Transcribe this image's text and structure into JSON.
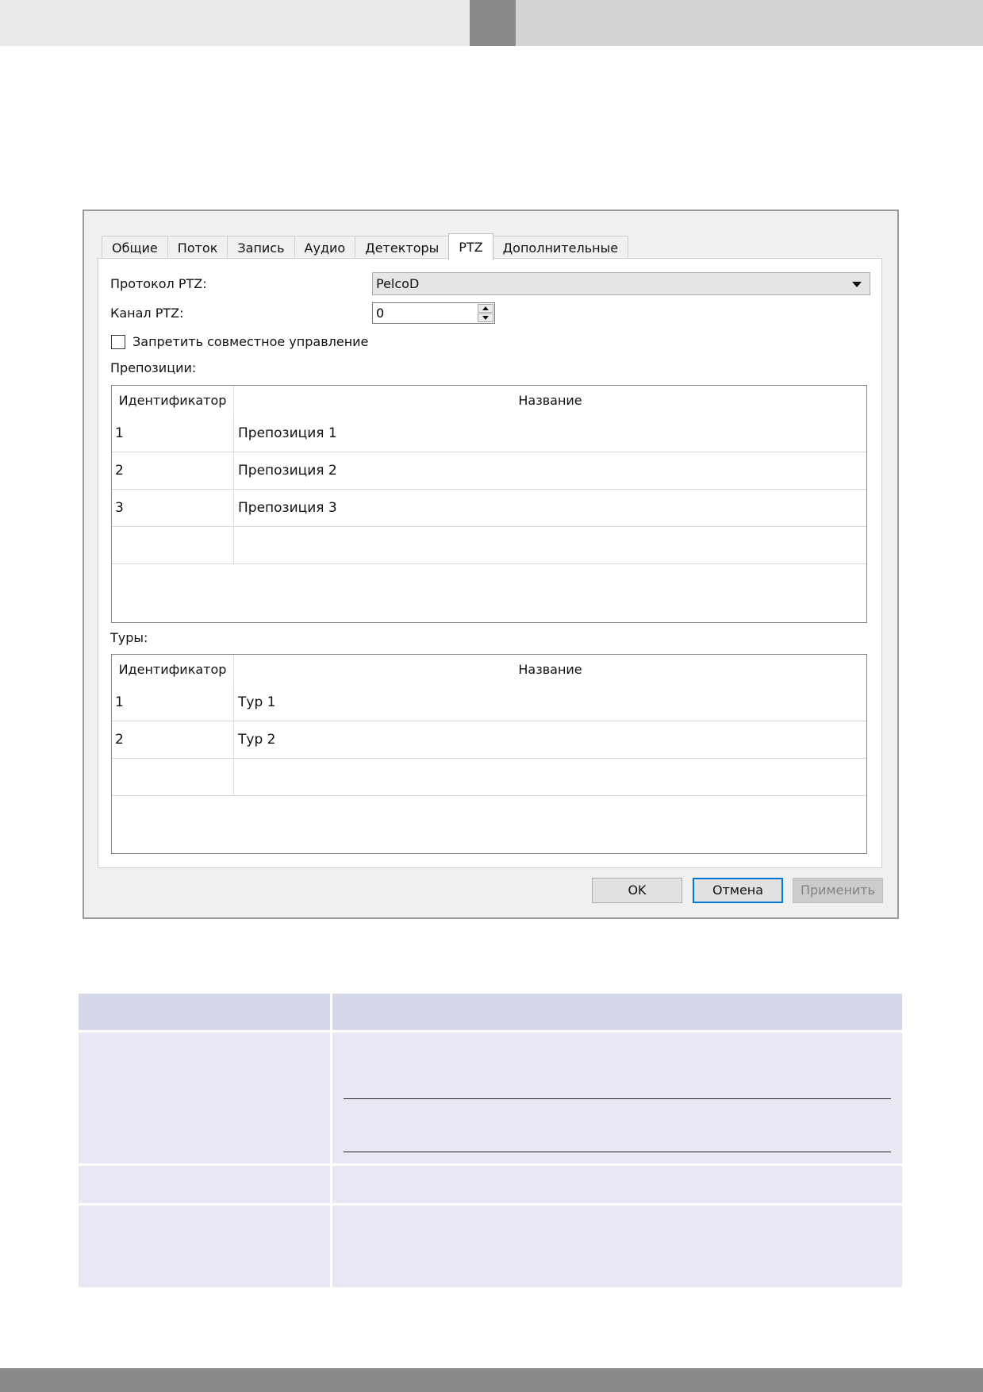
{
  "tabs": [
    "Общие",
    "Поток",
    "Запись",
    "Аудио",
    "Детекторы",
    "PTZ",
    "Дополнительные"
  ],
  "active_tab": "PTZ",
  "form": {
    "protocol_label": "Протокол PTZ:",
    "protocol_value": "PelcoD",
    "channel_label": "Канал PTZ:",
    "channel_value": "0",
    "disable_shared_label": "Запретить совместное управление",
    "disable_shared_checked": false
  },
  "presets": {
    "label": "Препозиции:",
    "columns": [
      "Идентификатор",
      "Название"
    ],
    "rows": [
      {
        "id": "1",
        "name": "Препозиция 1"
      },
      {
        "id": "2",
        "name": "Препозиция 2"
      },
      {
        "id": "3",
        "name": "Препозиция 3"
      },
      {
        "id": "",
        "name": ""
      }
    ]
  },
  "tours": {
    "label": "Туры:",
    "columns": [
      "Идентификатор",
      "Название"
    ],
    "rows": [
      {
        "id": "1",
        "name": "Тур 1"
      },
      {
        "id": "2",
        "name": "Тур 2"
      },
      {
        "id": "",
        "name": ""
      }
    ]
  },
  "buttons": {
    "ok": "OK",
    "cancel": "Отмена",
    "apply": "Применить"
  }
}
